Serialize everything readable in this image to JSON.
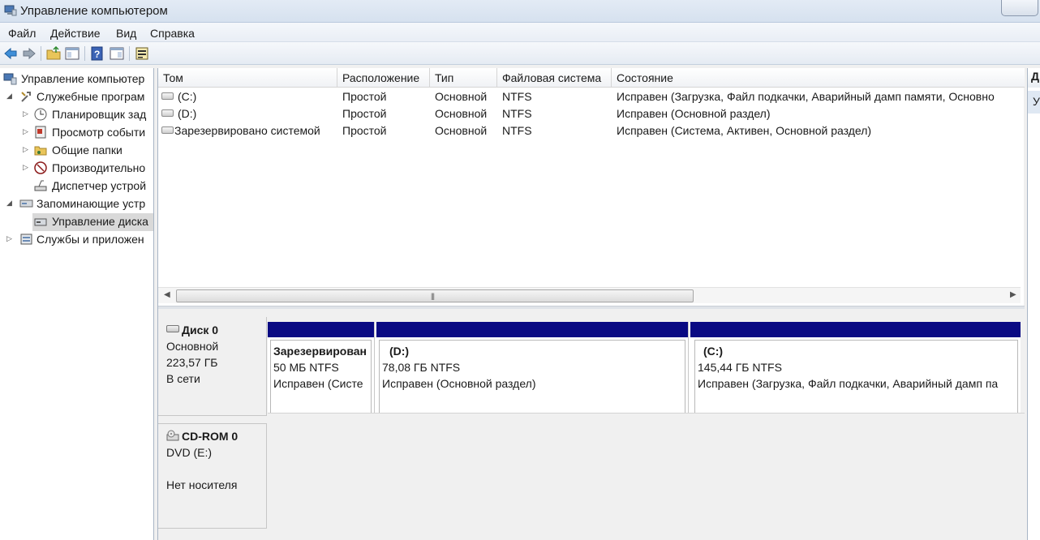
{
  "window": {
    "title": "Управление компьютером"
  },
  "menu": {
    "items": [
      "Файл",
      "Действие",
      "Вид",
      "Справка"
    ]
  },
  "toolbar": {
    "icons": [
      "back-arrow-icon",
      "forward-arrow-icon",
      "up-folder-icon",
      "show-hide-tree-icon",
      "help-icon",
      "show-hide-action-pane-icon",
      "properties-icon"
    ]
  },
  "tree": {
    "root": "Управление компьютер",
    "items": [
      {
        "label": "Служебные програм",
        "icon": "tools-icon"
      },
      {
        "label": "Планировщик зад",
        "icon": "clock-icon"
      },
      {
        "label": "Просмотр событи",
        "icon": "event-viewer-icon"
      },
      {
        "label": "Общие папки",
        "icon": "shared-folder-icon"
      },
      {
        "label": "Производительно",
        "icon": "performance-icon"
      },
      {
        "label": "Диспетчер устрой",
        "icon": "device-manager-icon"
      },
      {
        "label": "Запоминающие устр",
        "icon": "storage-icon"
      },
      {
        "label": "Управление диска",
        "icon": "disk-management-icon"
      },
      {
        "label": "Службы и приложен",
        "icon": "services-icon"
      }
    ]
  },
  "volumes": {
    "columns": [
      "Том",
      "Расположение",
      "Тип",
      "Файловая система",
      "Состояние"
    ],
    "rows": [
      {
        "name": "(C:)",
        "layout": "Простой",
        "type": "Основной",
        "fs": "NTFS",
        "status": "Исправен (Загрузка, Файл подкачки, Аварийный дамп памяти, Основно"
      },
      {
        "name": "(D:)",
        "layout": "Простой",
        "type": "Основной",
        "fs": "NTFS",
        "status": "Исправен (Основной раздел)"
      },
      {
        "name": "Зарезервировано системой",
        "layout": "Простой",
        "type": "Основной",
        "fs": "NTFS",
        "status": "Исправен (Система, Активен, Основной раздел)"
      }
    ]
  },
  "disk0": {
    "name": "Диск 0",
    "type": "Основной",
    "size": "223,57 ГБ",
    "state": "В сети",
    "partitions": [
      {
        "title": "Зарезервирован",
        "size": "50 МБ NTFS",
        "status": "Исправен (Систе"
      },
      {
        "title": "(D:)",
        "size": "78,08 ГБ NTFS",
        "status": "Исправен (Основной раздел)"
      },
      {
        "title": "(C:)",
        "size": "145,44 ГБ NTFS",
        "status": "Исправен (Загрузка, Файл подкачки, Аварийный дамп па"
      }
    ]
  },
  "cdrom0": {
    "name": "CD-ROM 0",
    "drive": "DVD (E:)",
    "state": "Нет носителя"
  },
  "actions": {
    "header": "Д",
    "item": "У"
  },
  "colors": {
    "partition_bar": "#0a0a83",
    "selection": "#dfe8f3"
  }
}
